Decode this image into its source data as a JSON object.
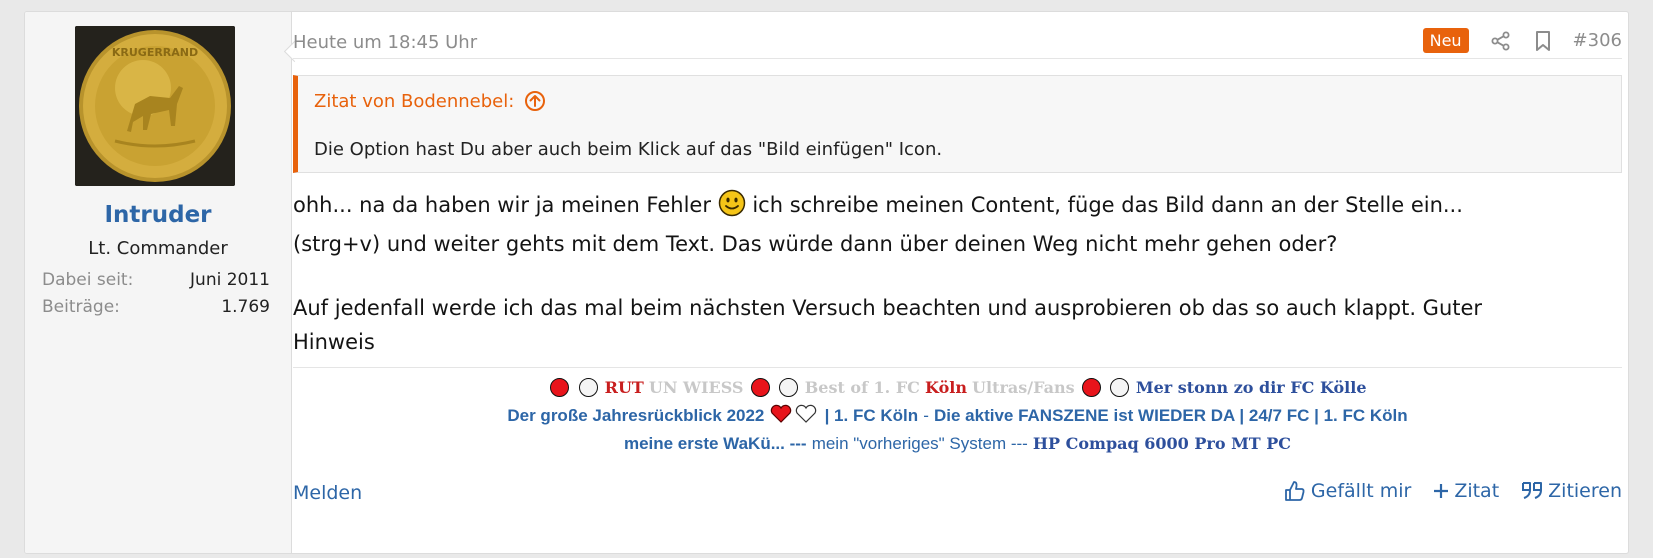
{
  "user": {
    "avatar_alt": "Krugerrand coin avatar",
    "name": "Intruder",
    "title": "Lt. Commander",
    "stats": [
      {
        "label": "Dabei seit:",
        "value": "Juni 2011"
      },
      {
        "label": "Beiträge:",
        "value": "1.769"
      }
    ]
  },
  "meta": {
    "time": "Heute um 18:45 Uhr",
    "badge": "Neu",
    "post_number": "#306"
  },
  "quote": {
    "header": "Zitat von Bodennebel:",
    "text": "Die Option hast Du aber auch beim Klick auf das \"Bild einfügen\" Icon."
  },
  "content": {
    "p1_before": "ohh... na da haben wir ja meinen Fehler ",
    "p1_after": " ich schreibe meinen Content, füge das Bild dann an der Stelle ein... (strg+v) und weiter gehts mit dem Text. Das würde dann über deinen Weg nicht mehr gehen oder?",
    "p2": "Auf jedenfall werde ich das mal beim nächsten Versuch beachten und ausprobieren ob das so auch klappt. Guter Hinweis"
  },
  "signature": {
    "rut": "RUT",
    "un_wiess": "UN WIESS",
    "best_of": "Best of 1. FC",
    "koln": "Köln",
    "ultras": "Ultras/Fans",
    "mer_stonn": "Mer stonn zo dir FC Kölle",
    "jahres": "Der große Jahresrückblick 2022",
    "fc_koln_link": "| 1. FC Köln",
    "dash": "-",
    "fanszene": "Die aktive FANSZENE ist WIEDER DA | 24/7 FC | 1. FC Köln",
    "erste_waku": "meine erste WaKü... ---",
    "vorheriges": "mein \"vorheriges\" System ---",
    "hp": "HP Compaq 6000 Pro MT PC"
  },
  "footer": {
    "report": "Melden",
    "like": "Gefällt mir",
    "plus_quote": "Zitat",
    "reply": "Zitieren"
  },
  "colors": {
    "accent": "#e8620c",
    "link": "#2d66a7"
  }
}
